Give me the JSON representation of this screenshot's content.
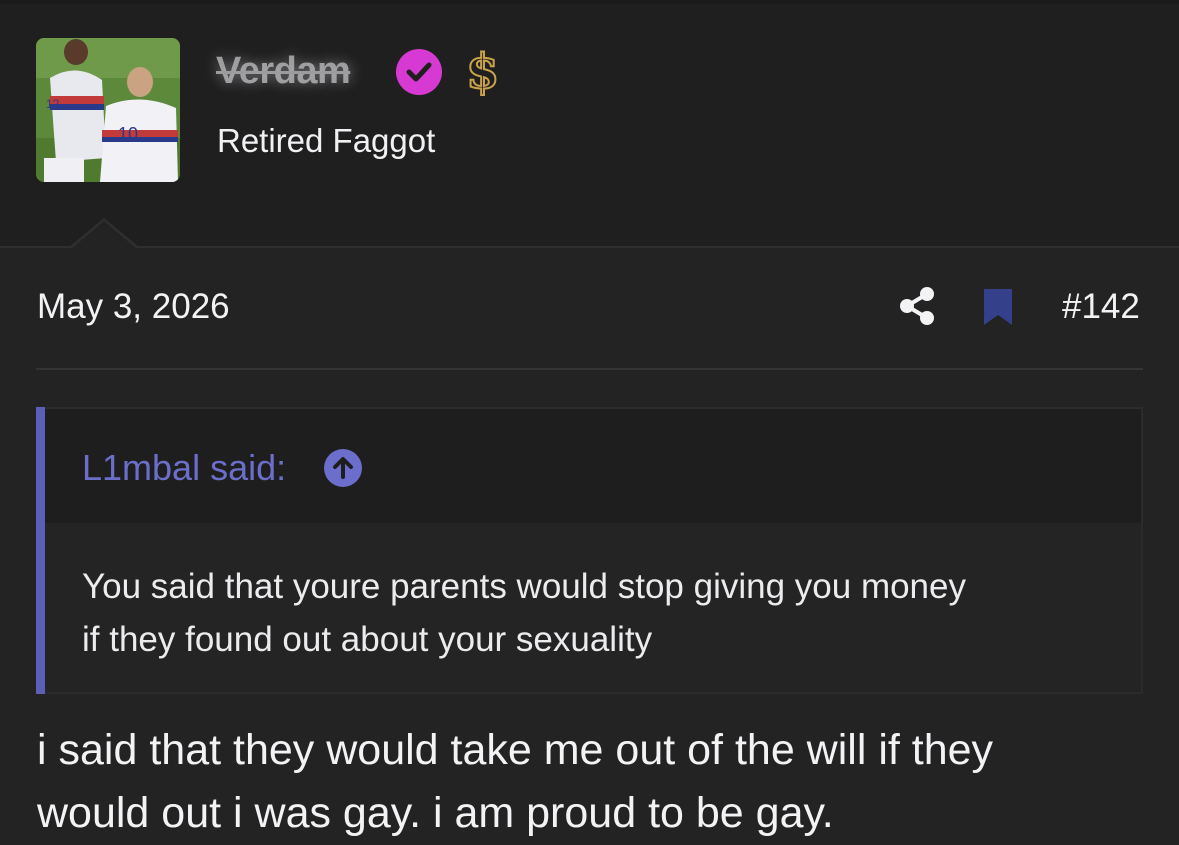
{
  "user": {
    "username": "Verdam",
    "title": "Retired Faggot",
    "badge_icons": [
      "verified-check-icon",
      "dollar-icon"
    ],
    "colors": {
      "verified": "#d63ad2",
      "dollar": "#c9a24a"
    }
  },
  "post": {
    "date": "May 3, 2026",
    "number": "#142",
    "actions": [
      "share-icon",
      "bookmark-icon"
    ]
  },
  "quote": {
    "author_label": "L1mbal said:",
    "lines": [
      "You said that youre parents would stop giving you money",
      "if they found out about your sexuality"
    ],
    "accent": "#6b6fcb"
  },
  "message": {
    "lines": [
      "i said that they would take me out of the will if they",
      "would out i was gay. i am proud to be gay."
    ]
  }
}
